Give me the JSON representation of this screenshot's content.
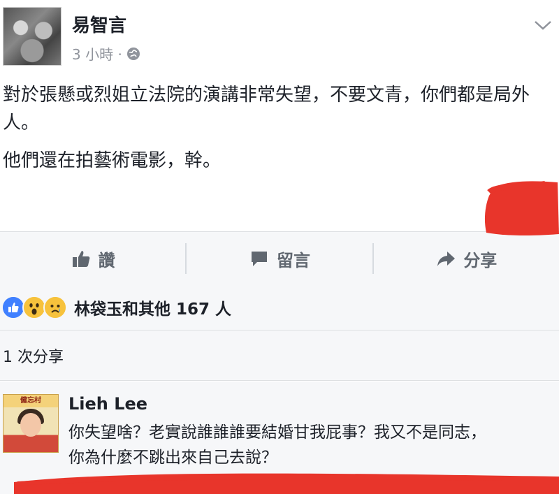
{
  "post": {
    "author": "易智言",
    "time": "3 小時 ·",
    "paragraphs": [
      "對於張懸或烈姐立法院的演講非常失望，不要文青，你們都是局外人。",
      "他們還在拍藝術電影，幹。"
    ]
  },
  "actions": {
    "like": "讚",
    "comment": "留言",
    "share": "分享"
  },
  "reactions": {
    "summary": "林袋玉和其他 167 人"
  },
  "shares": {
    "count_text": "1 次分享"
  },
  "comment": {
    "author": "Lieh Lee",
    "avatar_banner": "健忘村",
    "lines": [
      "你失望啥？老實說誰誰誰要結婚甘我屁事？我又不是同志，",
      "你為什麼不跳出來自己去說？"
    ]
  },
  "colors": {
    "scribble": "#e8352b",
    "like_blue": "#4080ff",
    "reaction_yellow": "#f7c23c"
  }
}
